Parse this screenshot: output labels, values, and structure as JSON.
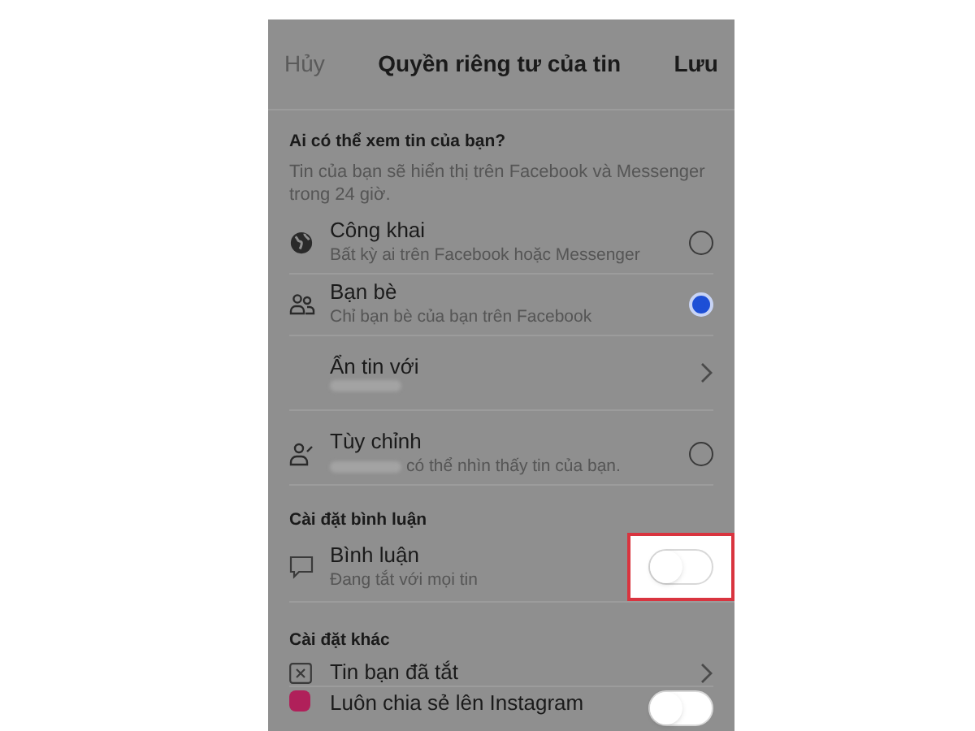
{
  "header": {
    "cancel": "Hủy",
    "title": "Quyền riêng tư của tin",
    "save": "Lưu"
  },
  "audience": {
    "heading": "Ai có thể xem tin của bạn?",
    "description": "Tin của bạn sẽ hiển thị trên Facebook và Messenger trong 24 giờ.",
    "options": [
      {
        "kind": "radio",
        "title": "Công khai",
        "subtitle": "Bất kỳ ai trên Facebook hoặc Messenger",
        "selected": false
      },
      {
        "kind": "radio",
        "title": "Bạn bè",
        "subtitle": "Chỉ bạn bè của bạn trên Facebook",
        "selected": true
      },
      {
        "kind": "link",
        "title": "Ẩn tin với",
        "subtitle_blurred": true
      },
      {
        "kind": "radio",
        "title": "Tùy chỉnh",
        "subtitle": "có thể nhìn thấy tin của bạn.",
        "subtitle_blurred": true,
        "selected": false
      }
    ]
  },
  "comments": {
    "heading": "Cài đặt bình luận",
    "title": "Bình luận",
    "subtitle": "Đang tắt với mọi tin",
    "on": false,
    "highlighted": true
  },
  "other": {
    "heading": "Cài đặt khác",
    "items": [
      {
        "kind": "link",
        "title": "Tin bạn đã tắt"
      },
      {
        "kind": "toggle",
        "title": "Luôn chia sẻ lên Instagram",
        "on": false
      }
    ]
  }
}
